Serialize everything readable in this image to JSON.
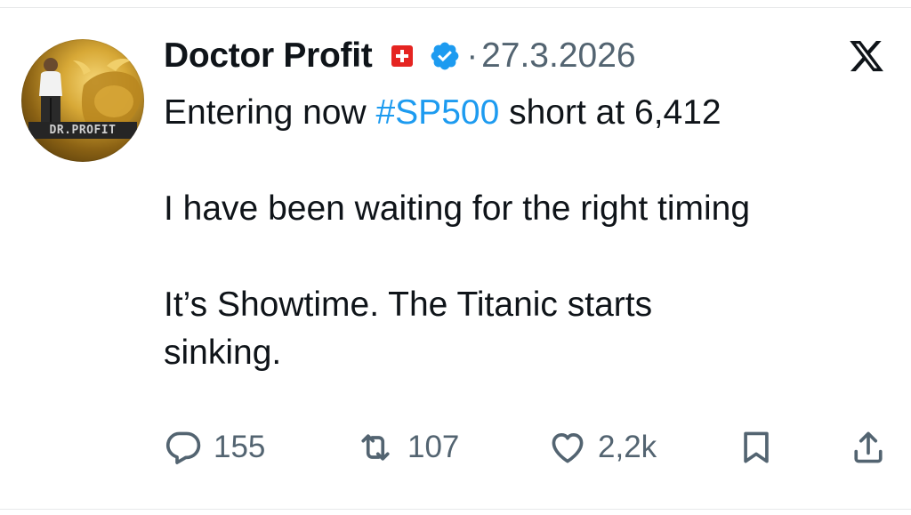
{
  "author": {
    "display_name": "Doctor Profit",
    "avatar_label": "DR.PROFIT",
    "flag_icon": "swiss-flag-icon",
    "verified_icon": "verified-badge-icon"
  },
  "meta": {
    "separator": "·",
    "date": "27.3.2026",
    "platform_icon": "x-logo-icon"
  },
  "tweet": {
    "line1_prefix": "Entering now ",
    "line1_hashtag": "#SP500",
    "line1_suffix": " short at 6,412",
    "line2": "I have been waiting for the right timing",
    "line3a": "It’s Showtime. The Titanic starts",
    "line3b": "sinking."
  },
  "actions": {
    "replies": "155",
    "reposts": "107",
    "likes": "2,2k",
    "reply_icon": "reply-icon",
    "repost_icon": "repost-icon",
    "like_icon": "heart-icon",
    "bookmark_icon": "bookmark-icon",
    "share_icon": "share-icon"
  },
  "colors": {
    "text": "#0f1419",
    "secondary": "#536471",
    "link": "#1d9bf0",
    "verified": "#1d9bf0",
    "swiss_red": "#e52421"
  }
}
